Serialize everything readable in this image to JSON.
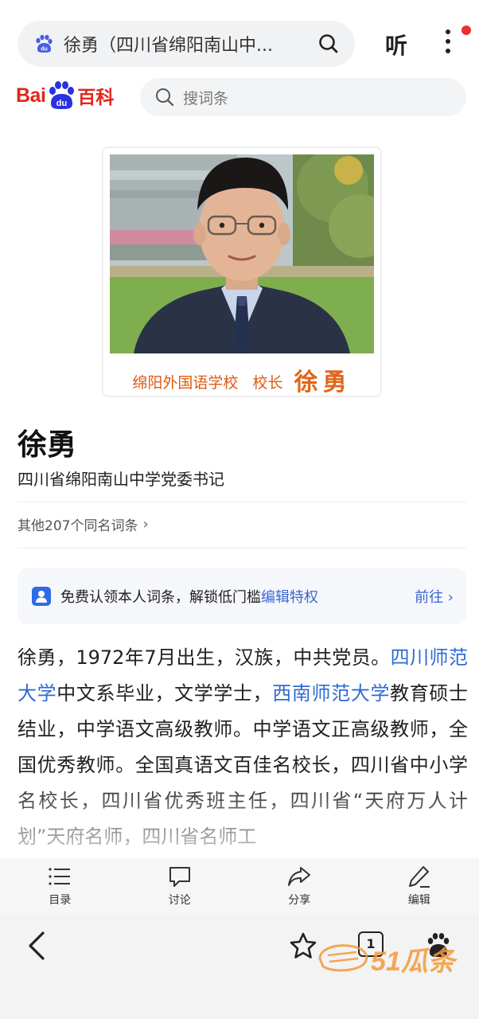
{
  "browser": {
    "url_title": "徐勇（四川省绵阳南山中...",
    "listen_label": "听"
  },
  "baike": {
    "logo_bai": "Bai",
    "logo_baike": "百科",
    "search_placeholder": "搜词条"
  },
  "portrait": {
    "caption_school": "绵阳外国语学校",
    "caption_role": "校长",
    "caption_name": "徐勇"
  },
  "entry": {
    "title": "徐勇",
    "subtitle": "四川省绵阳南山中学党委书记",
    "same_name_link": "其他207个同名词条"
  },
  "claim": {
    "text": "免费认领本人词条，解锁低门槛",
    "highlight": "编辑特权",
    "action": "前往 ›"
  },
  "summary": {
    "p1": "徐勇，1972年7月出生，汉族，中共党员。",
    "link1": "四川师范大学",
    "p2": "中文系毕业，文学学士，",
    "link2": "西南师范大学",
    "p3": "教育硕士结业，中学语文高级教师。中学语文正高级教师，全国优秀教师。全国真语文百佳名校长，四川省中小学名校长，四川省优秀班主任，四川省“天府万人计划”天府名师，四川省名师工"
  },
  "toolbar": {
    "items": [
      {
        "label": "目录",
        "icon": "list-icon"
      },
      {
        "label": "讨论",
        "icon": "comment-icon"
      },
      {
        "label": "分享",
        "icon": "share-icon"
      },
      {
        "label": "编辑",
        "icon": "edit-icon"
      }
    ]
  },
  "navbar": {
    "tab_count": "1"
  },
  "watermark": {
    "text": "51瓜条"
  },
  "colors": {
    "baidu_red": "#e1261c",
    "baidu_blue": "#2932e1",
    "link_blue": "#2f6bd4",
    "caption_orange": "#e05a14"
  }
}
